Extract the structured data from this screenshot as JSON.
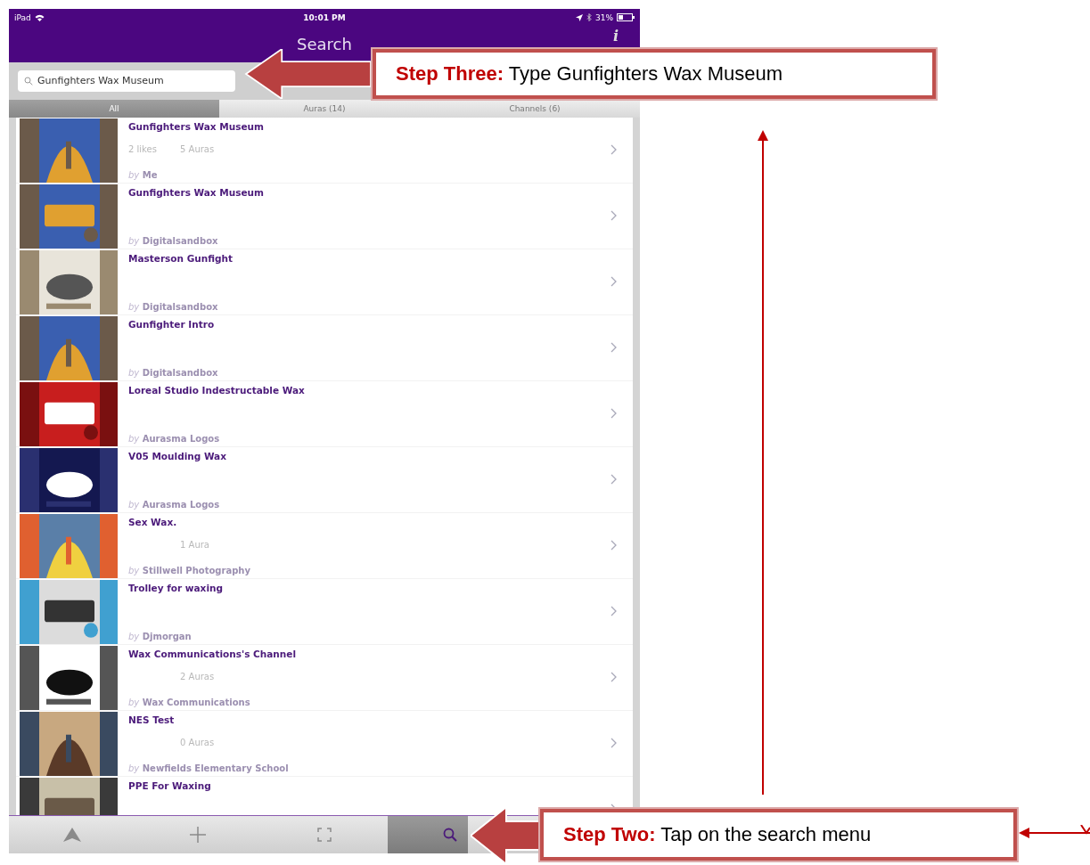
{
  "status_bar": {
    "device": "iPad",
    "time": "10:01 PM",
    "battery": "31%"
  },
  "nav_bar": {
    "title": "Search",
    "info": "i"
  },
  "search": {
    "value": "Gunfighters Wax Museum"
  },
  "tabs": [
    {
      "label": "All",
      "selected": true
    },
    {
      "label": "Auras (14)",
      "selected": false
    },
    {
      "label": "Channels (6)",
      "selected": false
    }
  ],
  "results": [
    {
      "title": "Gunfighters Wax Museum",
      "likes": "2 likes",
      "auras": "5 Auras",
      "byline": "*by* Me"
    },
    {
      "title": "Gunfighters Wax Museum",
      "byline": "*by* Digitalsandbox"
    },
    {
      "title": "Masterson Gunfight",
      "byline": "*by* Digitalsandbox"
    },
    {
      "title": "Gunfighter Intro",
      "byline": "*by* Digitalsandbox"
    },
    {
      "title": "Loreal Studio Indestructable Wax",
      "byline": "*by* Aurasma Logos"
    },
    {
      "title": "V05 Moulding Wax",
      "byline": "*by* Aurasma Logos"
    },
    {
      "title": "Sex Wax.",
      "auras": "1 Aura",
      "byline": "*by* Stillwell Photography"
    },
    {
      "title": "Trolley for waxing",
      "byline": "*by* Djmorgan"
    },
    {
      "title": "Wax Communications's Channel",
      "auras": "2 Auras",
      "byline": "*by* Wax Communications"
    },
    {
      "title": "NES Test",
      "auras": "0 Auras",
      "byline": "*by* Newfields Elementary School"
    },
    {
      "title": "PPE For Waxing"
    }
  ],
  "toolbar": [
    {
      "kind": "home",
      "selected": false
    },
    {
      "kind": "add",
      "selected": false
    },
    {
      "kind": "scan",
      "selected": false
    },
    {
      "kind": "search",
      "selected": true
    }
  ],
  "callouts": [
    {
      "text": "**Step Three:** Type Gunfighters Wax Museum"
    },
    {
      "text": "**Step Two:** Tap on the search menu"
    }
  ]
}
